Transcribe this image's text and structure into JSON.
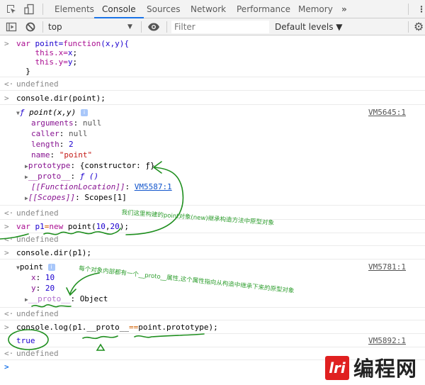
{
  "devtools": {
    "tabs": [
      {
        "label": "Elements",
        "active": false
      },
      {
        "label": "Console",
        "active": true
      },
      {
        "label": "Sources",
        "active": false
      },
      {
        "label": "Network",
        "active": false
      },
      {
        "label": "Performance",
        "active": false
      },
      {
        "label": "Memory",
        "active": false
      }
    ],
    "more_tabs_glyph": "»",
    "kebab_glyph": "⋮",
    "accent_color": "#1a73e8"
  },
  "toolbar": {
    "context": "top",
    "context_arrow": "▼",
    "filter_placeholder": "Filter",
    "levels_label": "Default levels ▼"
  },
  "console": {
    "entries": {
      "e1": {
        "prompt": ">",
        "l1a": "var",
        "l1b": " point=",
        "l1c": "function",
        "l1d": "(x,y){",
        "l2a": "    this",
        "l2b": ".x=",
        "l2c": "x",
        "l2d": ";",
        "l3a": "    this",
        "l3b": ".y=",
        "l3c": "y",
        "l3d": ";",
        "l4": "  }"
      },
      "r1": {
        "prompt": "<·",
        "text": "undefined"
      },
      "e2": {
        "prompt": ">",
        "text": "console.dir(point);"
      },
      "o2": {
        "header_f": "ƒ",
        "header_name": "point(x,y)",
        "info": "i",
        "source": "VM5645:1",
        "props": [
          {
            "key": "arguments",
            "value": "null"
          },
          {
            "key": "caller",
            "value": "null"
          },
          {
            "key": "length",
            "value": "2"
          },
          {
            "key": "name",
            "value": "\"point\""
          }
        ],
        "prototype_key": "prototype",
        "prototype_value": "{constructor: ƒ}",
        "proto_key": "__proto__",
        "proto_value": "ƒ ()",
        "fnloc_key": "[[FunctionLocation]]",
        "fnloc_value": "VM5587:1",
        "scopes_key": "[[Scopes]]",
        "scopes_value": "Scopes[1]"
      },
      "r2": {
        "prompt": "<·",
        "text": "undefined"
      },
      "e3": {
        "prompt": ">",
        "a": "var",
        "b": " p1",
        "c": "=",
        "d": "new",
        "e": " point(",
        "f": "10",
        "g": ",",
        "h": "20",
        "i": ");"
      },
      "r3": {
        "prompt": "<·",
        "text": "undefined"
      },
      "e4": {
        "prompt": ">",
        "text": "console.dir(p1);"
      },
      "o4": {
        "header": "point",
        "info": "i",
        "source": "VM5781:1",
        "x_key": "x",
        "x_value": "10",
        "y_key": "y",
        "y_value": "20",
        "proto_key": "__proto__",
        "proto_value": "Object"
      },
      "r4": {
        "prompt": "<·",
        "text": "undefined"
      },
      "e5": {
        "prompt": ">",
        "a": "console.log(p1.__proto__",
        "b": "==",
        "c": "point.prototype);"
      },
      "o5": {
        "text": "true",
        "source": "VM5892:1"
      },
      "r5": {
        "prompt": "<·",
        "text": "undefined"
      },
      "input_prompt": ">"
    }
  },
  "annotations": {
    "note1": "我们这里构建的point对象(new)继承构造方法中原型对象",
    "note2": "每个对象内部都有一个__proto__属性,这个属性指向从构造中继承下来的原型对象",
    "color": "#2e9e2e"
  },
  "watermark": {
    "logo_glyph": "lri",
    "text": "编程网"
  }
}
